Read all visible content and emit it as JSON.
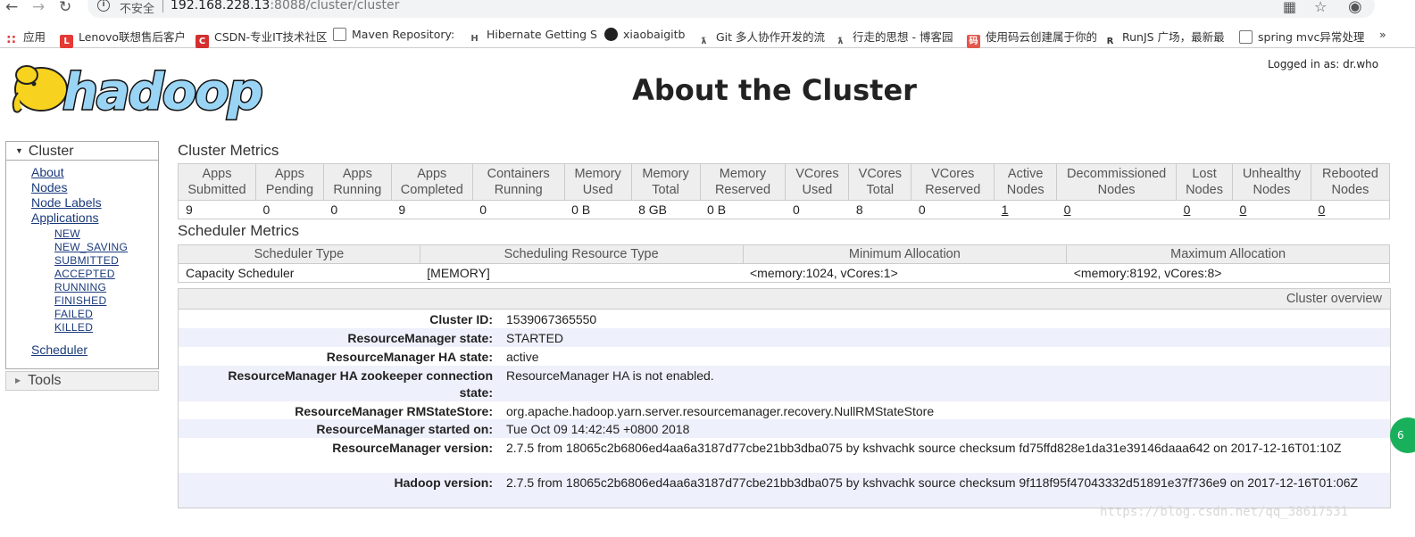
{
  "browser": {
    "insecure_label": "不安全",
    "url_host": "192.168.228.13",
    "url_rest": ":8088/cluster/cluster",
    "bookmarks": [
      {
        "label": "应用"
      },
      {
        "label": "Lenovo联想售后客户"
      },
      {
        "label": "CSDN-专业IT技术社区"
      },
      {
        "label": "Maven Repository: "
      },
      {
        "label": "Hibernate Getting S"
      },
      {
        "label": "xiaobaigitb"
      },
      {
        "label": "Git 多人协作开发的流"
      },
      {
        "label": "行走的思想 - 博客园"
      },
      {
        "label": "使用码云创建属于你的"
      },
      {
        "label": "RunJS 广场，最新最"
      },
      {
        "label": "spring mvc异常处理"
      }
    ]
  },
  "header": {
    "logged_in": "Logged in as: dr.who",
    "title": "About the Cluster"
  },
  "sidebar": {
    "cluster_label": "Cluster",
    "links": [
      "About",
      "Nodes",
      "Node Labels",
      "Applications"
    ],
    "app_states": [
      "NEW",
      "NEW_SAVING",
      "SUBMITTED",
      "ACCEPTED",
      "RUNNING",
      "FINISHED",
      "FAILED",
      "KILLED"
    ],
    "scheduler_label": "Scheduler",
    "tools_label": "Tools"
  },
  "cluster_metrics": {
    "title": "Cluster Metrics",
    "headers": [
      [
        "Apps",
        "Submitted"
      ],
      [
        "Apps",
        "Pending"
      ],
      [
        "Apps",
        "Running"
      ],
      [
        "Apps",
        "Completed"
      ],
      [
        "Containers",
        "Running"
      ],
      [
        "Memory",
        "Used"
      ],
      [
        "Memory",
        "Total"
      ],
      [
        "Memory",
        "Reserved"
      ],
      [
        "VCores",
        "Used"
      ],
      [
        "VCores",
        "Total"
      ],
      [
        "VCores",
        "Reserved"
      ],
      [
        "Active",
        "Nodes"
      ],
      [
        "Decommissioned",
        "Nodes"
      ],
      [
        "Lost",
        "Nodes"
      ],
      [
        "Unhealthy",
        "Nodes"
      ],
      [
        "Rebooted",
        "Nodes"
      ]
    ],
    "values": [
      "9",
      "0",
      "0",
      "9",
      "0",
      "0 B",
      "8 GB",
      "0 B",
      "0",
      "8",
      "0",
      "1",
      "0",
      "0",
      "0",
      "0"
    ]
  },
  "scheduler_metrics": {
    "title": "Scheduler Metrics",
    "headers": [
      "Scheduler Type",
      "Scheduling Resource Type",
      "Minimum Allocation",
      "Maximum Allocation"
    ],
    "values": [
      "Capacity Scheduler",
      "[MEMORY]",
      "<memory:1024, vCores:1>",
      "<memory:8192, vCores:8>"
    ]
  },
  "overview": {
    "title": "Cluster overview",
    "rows": [
      {
        "key": "Cluster ID:",
        "value": "1539067365550"
      },
      {
        "key": "ResourceManager state:",
        "value": "STARTED"
      },
      {
        "key": "ResourceManager HA state:",
        "value": "active"
      },
      {
        "key": "ResourceManager HA zookeeper connection state:",
        "value": "ResourceManager HA is not enabled."
      },
      {
        "key": "ResourceManager RMStateStore:",
        "value": "org.apache.hadoop.yarn.server.resourcemanager.recovery.NullRMStateStore"
      },
      {
        "key": "ResourceManager started on:",
        "value": "Tue Oct 09 14:42:45 +0800 2018"
      },
      {
        "key": "ResourceManager version:",
        "value": "2.7.5 from 18065c2b6806ed4aa6a3187d77cbe21bb3dba075 by kshvachk source checksum fd75ffd828e1da31e39146daaa642 on 2017-12-16T01:10Z"
      },
      {
        "key": "Hadoop version:",
        "value": "2.7.5 from 18065c2b6806ed4aa6a3187d77cbe21bb3dba075 by kshvachk source checksum 9f118f95f47043332d51891e37f736e9 on 2017-12-16T01:06Z"
      }
    ]
  },
  "watermark": "https://blog.csdn.net/qq_38617531",
  "badge": "6"
}
